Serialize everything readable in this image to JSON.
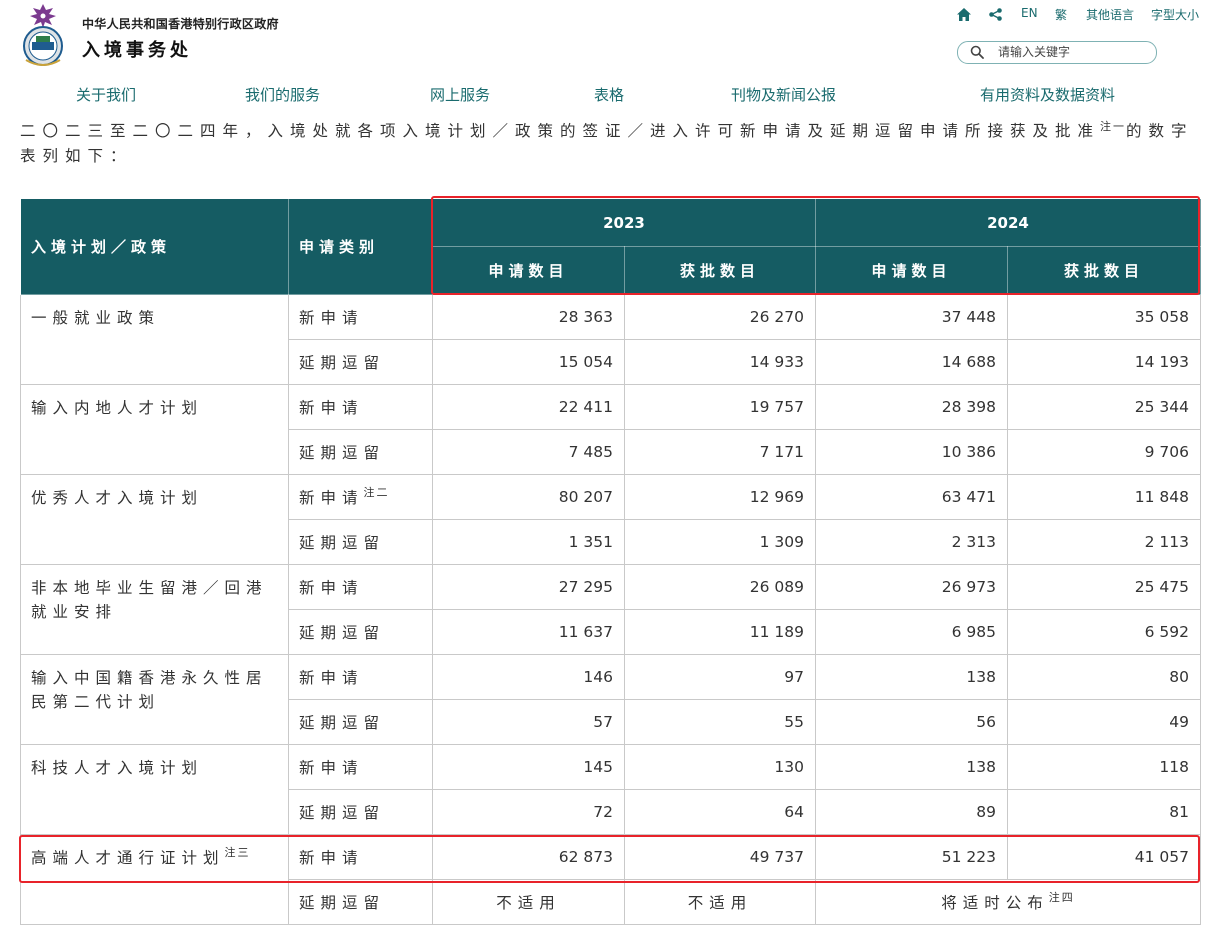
{
  "header": {
    "gov_name": "中华人民共和国香港特别行政区政府",
    "dept_name": "入境事务处",
    "util": {
      "english": "EN",
      "traditional": "繁",
      "other_lang": "其他语言",
      "font_size": "字型大小"
    },
    "search_placeholder": "请输入关键字"
  },
  "nav": [
    "关于我们",
    "我们的服务",
    "网上服务",
    "表格",
    "刊物及新闻公报",
    "有用资料及数据资料"
  ],
  "intro": {
    "text": "二〇二三至二〇二四年，入境处就各项入境计划／政策的签证／进入许可新申请及延期逗留申请所接获及批准",
    "note": "注一",
    "tail": "的数字表列如下："
  },
  "table": {
    "headers": {
      "policy": "入境计划／政策",
      "category": "申请类别",
      "year1": "2023",
      "year2": "2024",
      "applied": "申请数目",
      "approved": "获批数目"
    },
    "groups": [
      {
        "policy": "一般就业政策",
        "policy_note": "",
        "rows": [
          {
            "cat": "新申请",
            "cat_note": "",
            "v": [
              "28 363",
              "26 270",
              "37 448",
              "35 058"
            ]
          },
          {
            "cat": "延期逗留",
            "cat_note": "",
            "v": [
              "15 054",
              "14 933",
              "14 688",
              "14 193"
            ]
          }
        ]
      },
      {
        "policy": "输入内地人才计划",
        "policy_note": "",
        "rows": [
          {
            "cat": "新申请",
            "cat_note": "",
            "v": [
              "22 411",
              "19 757",
              "28 398",
              "25 344"
            ]
          },
          {
            "cat": "延期逗留",
            "cat_note": "",
            "v": [
              "7 485",
              "7 171",
              "10 386",
              "9 706"
            ]
          }
        ]
      },
      {
        "policy": "优秀人才入境计划",
        "policy_note": "",
        "rows": [
          {
            "cat": "新申请",
            "cat_note": "注二",
            "v": [
              "80 207",
              "12 969",
              "63 471",
              "11 848"
            ]
          },
          {
            "cat": "延期逗留",
            "cat_note": "",
            "v": [
              "1 351",
              "1 309",
              "2 313",
              "2 113"
            ]
          }
        ]
      },
      {
        "policy": "非本地毕业生留港／回港就业安排",
        "policy_note": "",
        "rows": [
          {
            "cat": "新申请",
            "cat_note": "",
            "v": [
              "27 295",
              "26 089",
              "26 973",
              "25 475"
            ]
          },
          {
            "cat": "延期逗留",
            "cat_note": "",
            "v": [
              "11 637",
              "11 189",
              "6 985",
              "6 592"
            ]
          }
        ]
      },
      {
        "policy": "输入中国籍香港永久性居民第二代计划",
        "policy_note": "",
        "rows": [
          {
            "cat": "新申请",
            "cat_note": "",
            "v": [
              "146",
              "97",
              "138",
              "80"
            ]
          },
          {
            "cat": "延期逗留",
            "cat_note": "",
            "v": [
              "57",
              "55",
              "56",
              "49"
            ]
          }
        ]
      },
      {
        "policy": "科技人才入境计划",
        "policy_note": "",
        "rows": [
          {
            "cat": "新申请",
            "cat_note": "",
            "v": [
              "145",
              "130",
              "138",
              "118"
            ]
          },
          {
            "cat": "延期逗留",
            "cat_note": "",
            "v": [
              "72",
              "64",
              "89",
              "81"
            ]
          }
        ]
      },
      {
        "policy": "高端人才通行证计划",
        "policy_note": "注三",
        "rows": [
          {
            "cat": "新申请",
            "cat_note": "",
            "v": [
              "62 873",
              "49 737",
              "51 223",
              "41 057"
            ]
          },
          {
            "cat": "延期逗留",
            "cat_note": "",
            "na": [
              "不适用",
              "不适用"
            ],
            "na2024": "将适时公布",
            "na2024_note": "注四"
          }
        ]
      }
    ]
  },
  "highlight_color": "#e8232a"
}
